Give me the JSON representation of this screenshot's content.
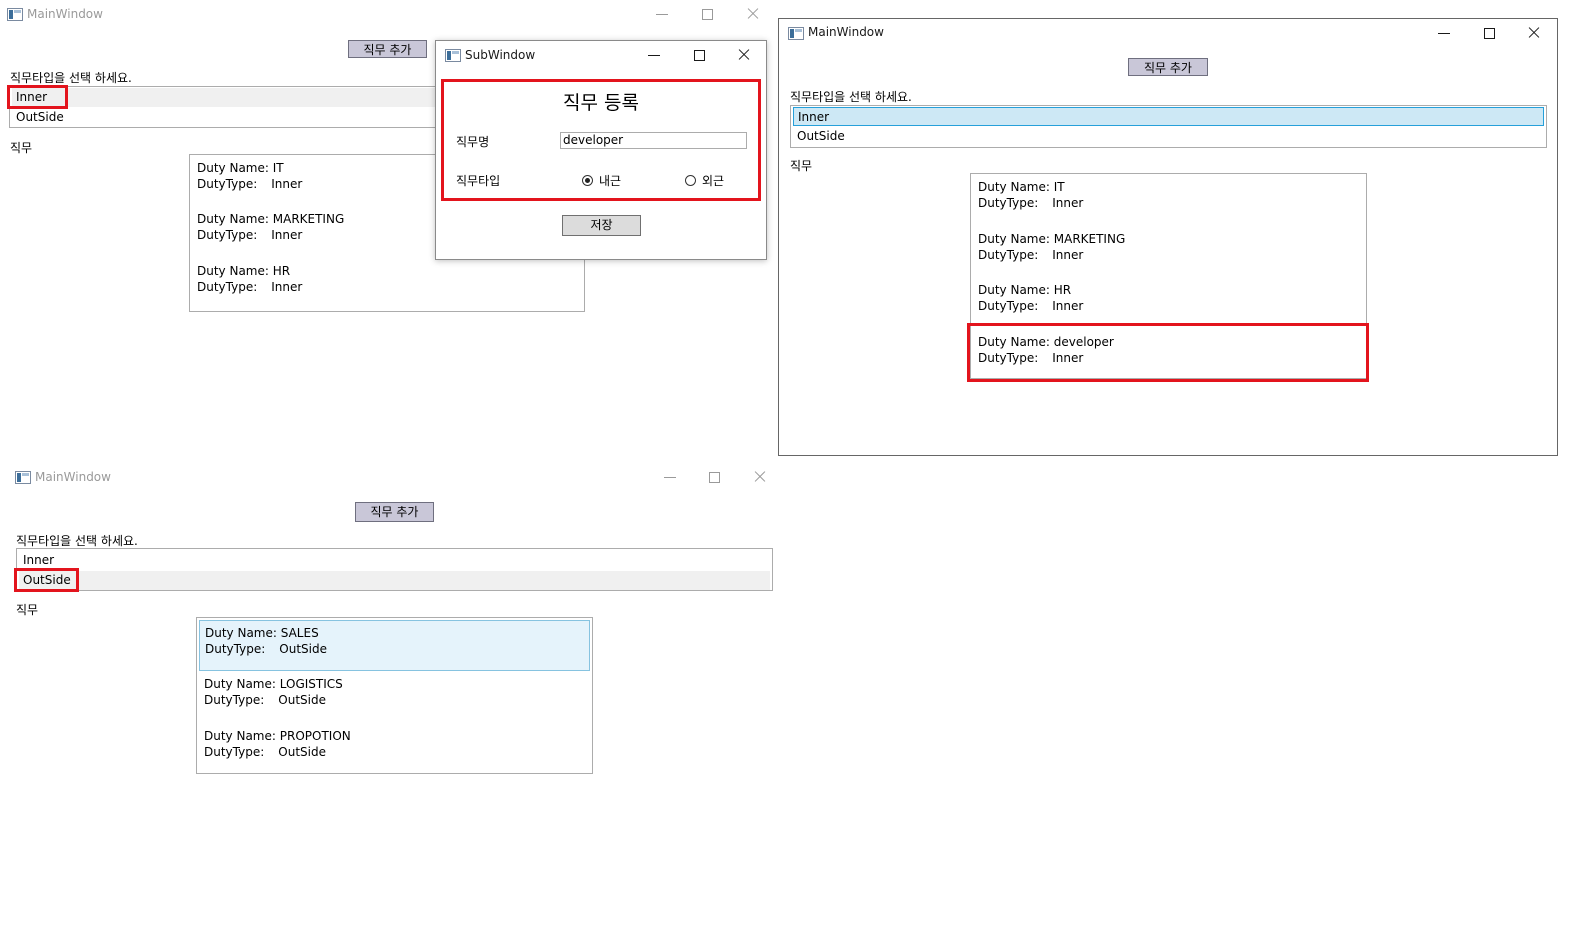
{
  "main_title": "MainWindow",
  "sub_title": "SubWindow",
  "add_button": "직무 추가",
  "select_prompt": "직무타입을 선택 하세요.",
  "types": [
    "Inner",
    "OutSide"
  ],
  "duty_label": "직무",
  "name_prefix": "Duty Name:",
  "type_prefix": "DutyType:",
  "win1": {
    "duties": [
      {
        "name": "IT",
        "type": "Inner"
      },
      {
        "name": "MARKETING",
        "type": "Inner"
      },
      {
        "name": "HR",
        "type": "Inner"
      }
    ]
  },
  "sub": {
    "heading": "직무 등록",
    "name_label": "직무명",
    "name_value": "developer",
    "type_label": "직무타입",
    "radio_inner": "내근",
    "radio_outer": "외근",
    "save": "저장"
  },
  "win2": {
    "duties": [
      {
        "name": "IT",
        "type": "Inner"
      },
      {
        "name": "MARKETING",
        "type": "Inner"
      },
      {
        "name": "HR",
        "type": "Inner"
      },
      {
        "name": "developer",
        "type": "Inner"
      }
    ]
  },
  "win3": {
    "duties": [
      {
        "name": "SALES",
        "type": "OutSide"
      },
      {
        "name": "LOGISTICS",
        "type": "OutSide"
      },
      {
        "name": "PROPOTION",
        "type": "OutSide"
      }
    ]
  },
  "colors": {
    "highlight": "#e3141d",
    "selection": "#cde8f5",
    "button": "#c9c7d8"
  }
}
